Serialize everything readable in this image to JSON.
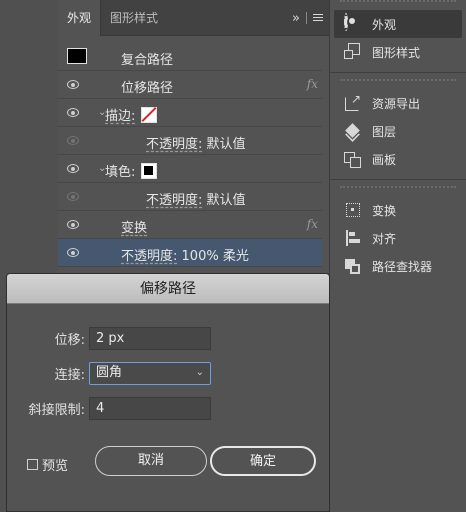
{
  "appearance_panel": {
    "tabs": [
      {
        "label": "外观"
      },
      {
        "label": "图形样式"
      }
    ],
    "collapse_label": "»",
    "rows": {
      "compound": {
        "label": "复合路径"
      },
      "offset_path": {
        "label": "位移路径",
        "fx": "fx"
      },
      "stroke": {
        "label": "描边:"
      },
      "stroke_opacity": {
        "label": "不透明度:",
        "value": "默认值"
      },
      "fill": {
        "label": "填色:"
      },
      "fill_opacity": {
        "label": "不透明度:",
        "value": "默认值"
      },
      "transform": {
        "label": "变换",
        "fx": "fx"
      },
      "opacity": {
        "label": "不透明度:",
        "value": "100% 柔光"
      }
    }
  },
  "right_dock": {
    "group1": [
      {
        "label": "外观",
        "icon": "appearance-icon"
      },
      {
        "label": "图形样式",
        "icon": "graphic-styles-icon"
      }
    ],
    "group2": [
      {
        "label": "资源导出",
        "icon": "asset-export-icon"
      },
      {
        "label": "图层",
        "icon": "layers-icon"
      },
      {
        "label": "画板",
        "icon": "artboards-icon"
      }
    ],
    "group3": [
      {
        "label": "变换",
        "icon": "transform-icon"
      },
      {
        "label": "对齐",
        "icon": "align-icon"
      },
      {
        "label": "路径查找器",
        "icon": "pathfinder-icon"
      }
    ]
  },
  "offset_dialog": {
    "title": "偏移路径",
    "offset": {
      "label": "位移:",
      "value": "2 px"
    },
    "joins": {
      "label": "连接:",
      "value": "圆角"
    },
    "miter_limit": {
      "label": "斜接限制:",
      "value": "4"
    },
    "preview_label": "预览",
    "cancel_label": "取消",
    "ok_label": "确定"
  }
}
